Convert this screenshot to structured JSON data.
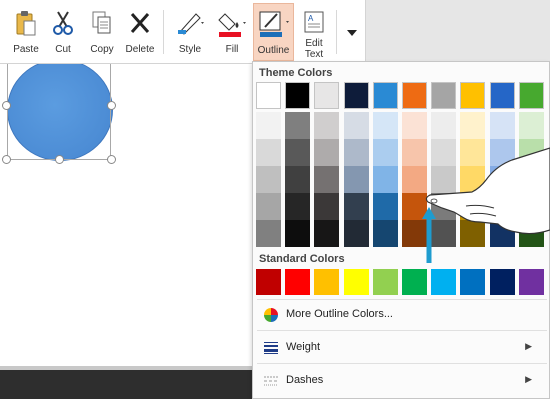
{
  "ribbon": {
    "paste": "Paste",
    "cut": "Cut",
    "copy": "Copy",
    "delete": "Delete",
    "style": "Style",
    "fill": "Fill",
    "outline": "Outline",
    "edit_text_line1": "Edit",
    "edit_text_line2": "Text"
  },
  "dropdown": {
    "theme_title": "Theme Colors",
    "standard_title": "Standard Colors",
    "more_colors": "More Outline Colors...",
    "weight": "Weight",
    "dashes": "Dashes"
  },
  "theme_colors": [
    [
      "#ffffff",
      "#000000",
      "#e7e6e6",
      "#0e1c3a",
      "#2a8ad4",
      "#ee6b13",
      "#a5a5a5",
      "#ffc000",
      "#2566c7",
      "#47a92f"
    ],
    [
      "#f2f2f2",
      "#7f7f7f",
      "#d0cece",
      "#d6dce5",
      "#d5e6f7",
      "#fbe2d5",
      "#ededed",
      "#fff2cc",
      "#d6e3f6",
      "#dcefd4"
    ],
    [
      "#d9d9d9",
      "#595959",
      "#aeabab",
      "#adb9ca",
      "#abcdef",
      "#f7c5ab",
      "#dbdbdb",
      "#ffe699",
      "#adc7ed",
      "#b9dfaa"
    ],
    [
      "#bfbfbf",
      "#404040",
      "#757171",
      "#8497b0",
      "#80b4e7",
      "#f3a983",
      "#c9c9c9",
      "#ffd966",
      "#84abe4",
      "#95cf80"
    ],
    [
      "#a6a6a6",
      "#262626",
      "#3b3838",
      "#323f4f",
      "#1f6aa8",
      "#c5550c",
      "#7b7b7b",
      "#bf9000",
      "#1b4c95",
      "#357f23"
    ],
    [
      "#808080",
      "#0d0d0d",
      "#171616",
      "#222a35",
      "#154670",
      "#833908",
      "#525252",
      "#7f6000",
      "#123263",
      "#235417"
    ]
  ],
  "standard_colors": [
    "#c00000",
    "#ff0000",
    "#ffc000",
    "#ffff00",
    "#92d050",
    "#00b050",
    "#00b0f0",
    "#0070c0",
    "#002060",
    "#7030a0"
  ],
  "colors": {
    "outline_highlight": "#f8d5c2",
    "fill_bar": "#e81123",
    "outline_bar": "#1d6fb8",
    "arrow": "#1e9ccf",
    "shape": "#4a8ad3"
  }
}
